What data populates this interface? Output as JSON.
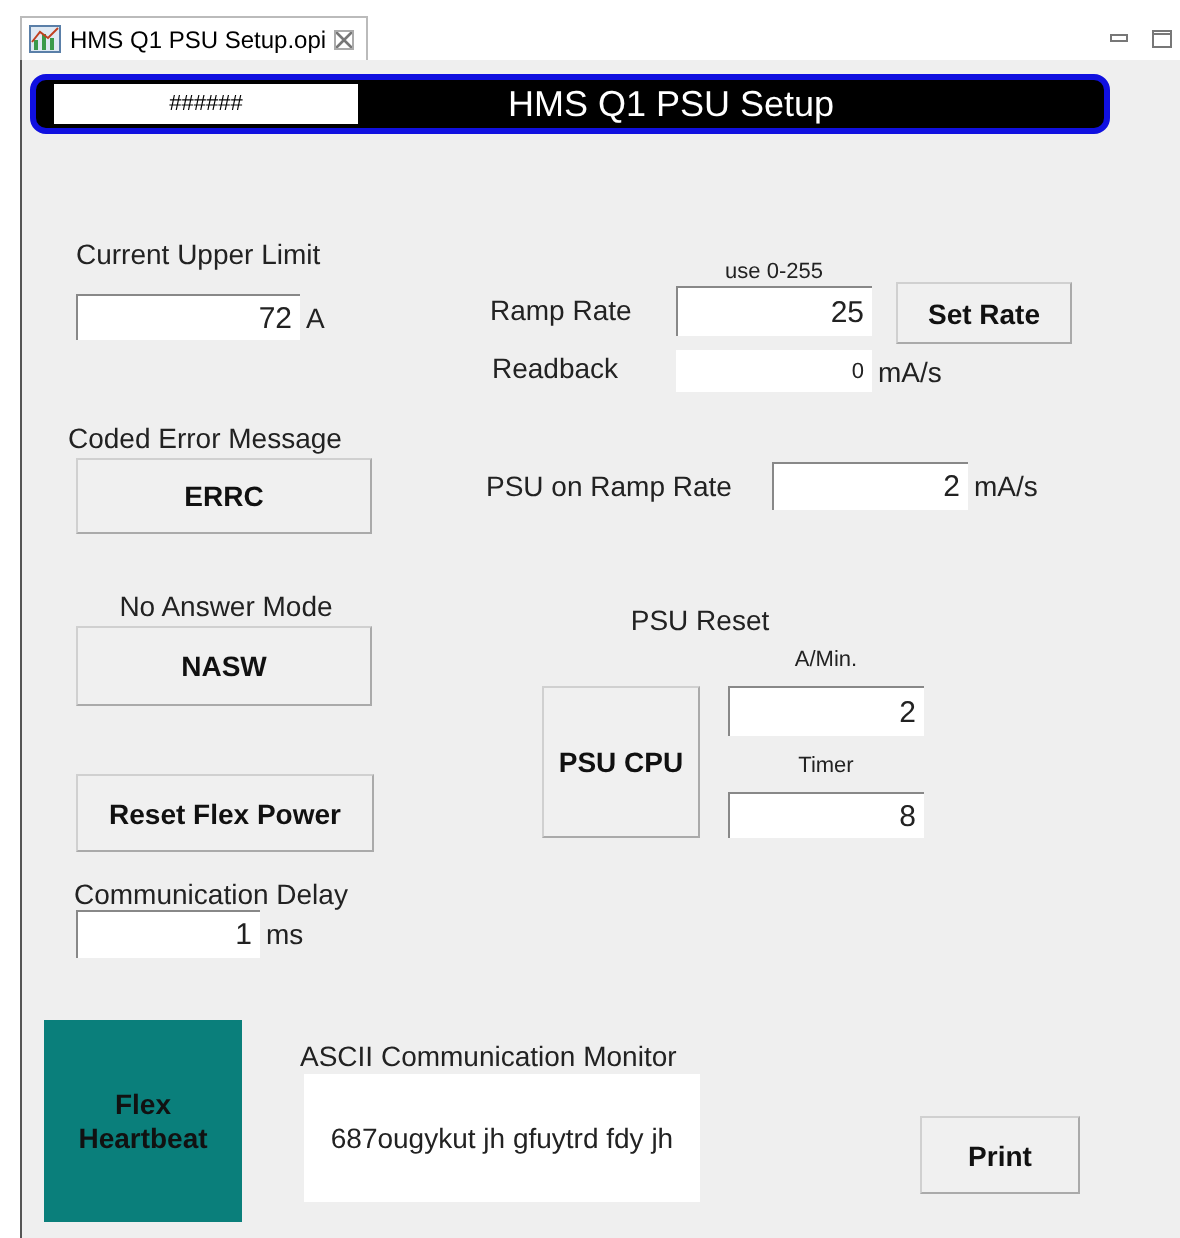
{
  "tab": {
    "title": "HMS Q1 PSU Setup.opi",
    "selected": true
  },
  "header": {
    "status": "######",
    "title": "HMS Q1 PSU Setup"
  },
  "widgets": [
    {
      "kind": "label",
      "text": "Current Upper Limit"
    },
    {
      "kind": "field",
      "value": "72",
      "unit": "A"
    },
    {
      "kind": "label",
      "text": "Coded Error Message"
    },
    {
      "kind": "button",
      "text": "ERRC"
    },
    {
      "kind": "label",
      "text": "No Answer Mode"
    },
    {
      "kind": "button",
      "text": "NASW"
    },
    {
      "kind": "button",
      "text": "Reset Flex Power"
    },
    {
      "kind": "label",
      "text": "Communication Delay"
    },
    {
      "kind": "field",
      "value": "1",
      "unit": "ms"
    },
    {
      "kind": "led",
      "text": "Flex Heartbeat",
      "color": "#0a7f7b"
    },
    {
      "kind": "label",
      "text": "ASCII Communication Monitor"
    },
    {
      "kind": "monitor",
      "value": "687ougykut jh gfuytrd fdy jh"
    },
    {
      "kind": "button",
      "text": "Print"
    },
    {
      "kind": "hint",
      "text": "use 0-255"
    },
    {
      "kind": "label",
      "text": "Ramp Rate"
    },
    {
      "kind": "field",
      "value": "25"
    },
    {
      "kind": "button",
      "text": "Set Rate"
    },
    {
      "kind": "label",
      "text": "Readback"
    },
    {
      "kind": "readout",
      "value": "0",
      "unit": "mA/s"
    },
    {
      "kind": "label",
      "text": "PSU on Ramp Rate"
    },
    {
      "kind": "field",
      "value": "2",
      "unit": "mA/s"
    },
    {
      "kind": "label",
      "text": "PSU Reset"
    },
    {
      "kind": "button",
      "text": "PSU CPU"
    },
    {
      "kind": "hint",
      "text": "A/Min."
    },
    {
      "kind": "field",
      "value": "2"
    },
    {
      "kind": "hint",
      "text": "Timer"
    },
    {
      "kind": "field",
      "value": "8"
    }
  ]
}
